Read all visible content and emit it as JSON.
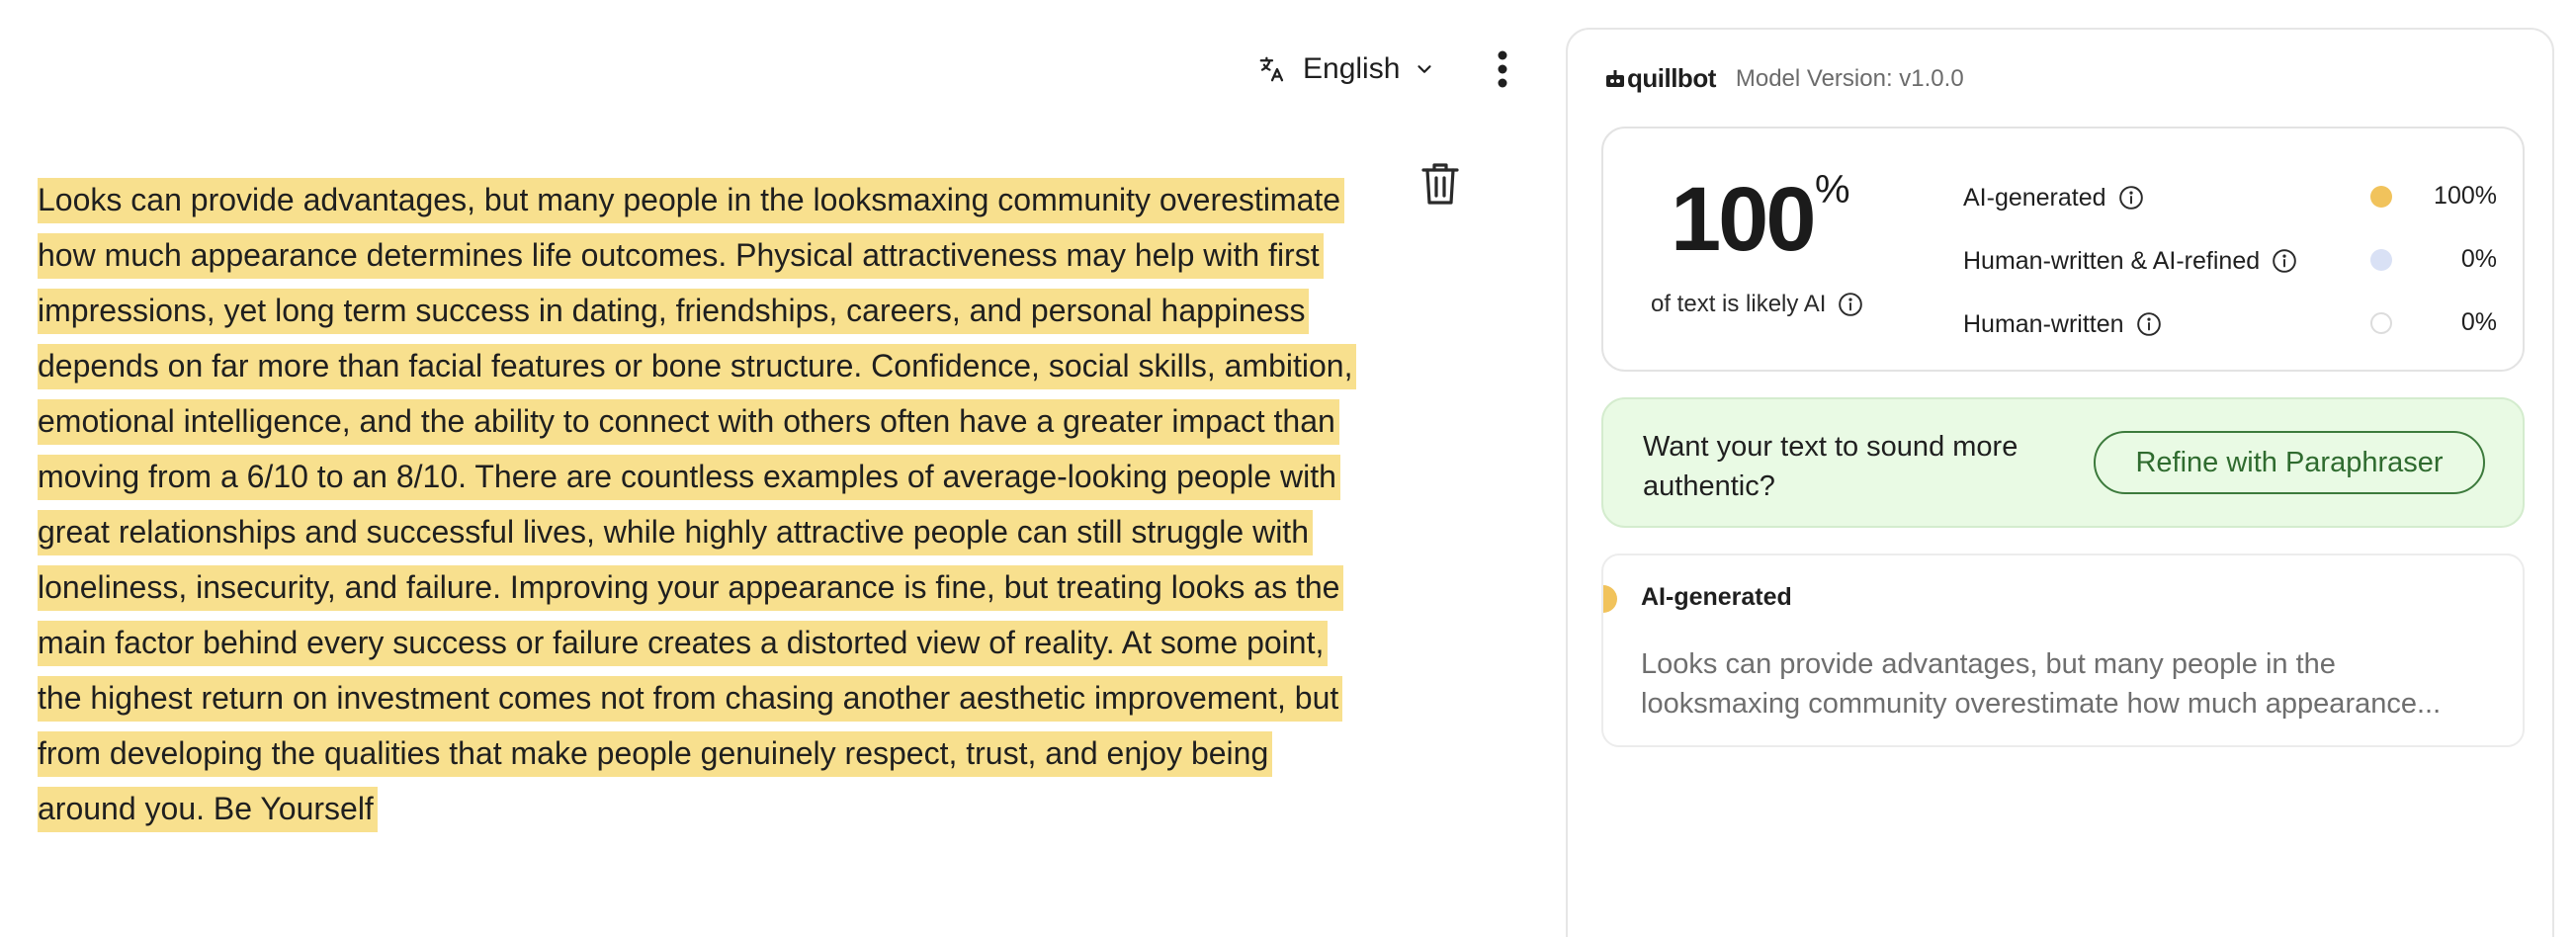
{
  "editor": {
    "language": "English",
    "text": "Looks can provide advantages, but many people in the looksmaxing community overestimate how much appearance determines life outcomes. Physical attractiveness may help with first impressions, yet long term success in dating, friendships, careers, and personal happiness depends on far more than facial features or bone structure. Confidence, social skills, ambition, emotional intelligence, and the ability to connect with others often have a greater impact than moving from a 6/10 to an 8/10. There are countless examples of average-looking people with great relationships and successful lives, while highly attractive people can still struggle with loneliness, insecurity, and failure. Improving your appearance is fine, but treating looks as the main factor behind every success or failure creates a distorted view of reality. At some point, the highest return on investment comes not from chasing another aesthetic improvement, but from developing the qualities that make people genuinely respect, trust, and enjoy being around you. Be Yourself",
    "highlight_color": "#f8e08e",
    "icons": {
      "language": "translate-icon",
      "dropdown": "chevron-down-icon",
      "more": "more-vertical-icon",
      "delete": "trash-icon"
    }
  },
  "panel": {
    "brand": "quillbot",
    "model_version": "Model Version: v1.0.0",
    "score": {
      "value": "100",
      "unit": "%",
      "caption": "of text is likely AI"
    },
    "breakdown": [
      {
        "label": "AI-generated",
        "value": "100%",
        "color": "#f1c35c"
      },
      {
        "label": "Human-written & AI-refined",
        "value": "0%",
        "color": "#d9e1f5"
      },
      {
        "label": "Human-written",
        "value": "0%",
        "color": "#ffffff"
      }
    ],
    "promo": {
      "text": "Want your text to sound more authentic?",
      "button": "Refine with Paraphraser",
      "background": "#e9fae4",
      "accent": "#2f6b2f"
    },
    "segment": {
      "title": "AI-generated",
      "excerpt": "Looks can provide advantages, but many people in the looksmaxing community overestimate how much appearance...",
      "marker_color": "#f1c35c"
    }
  }
}
